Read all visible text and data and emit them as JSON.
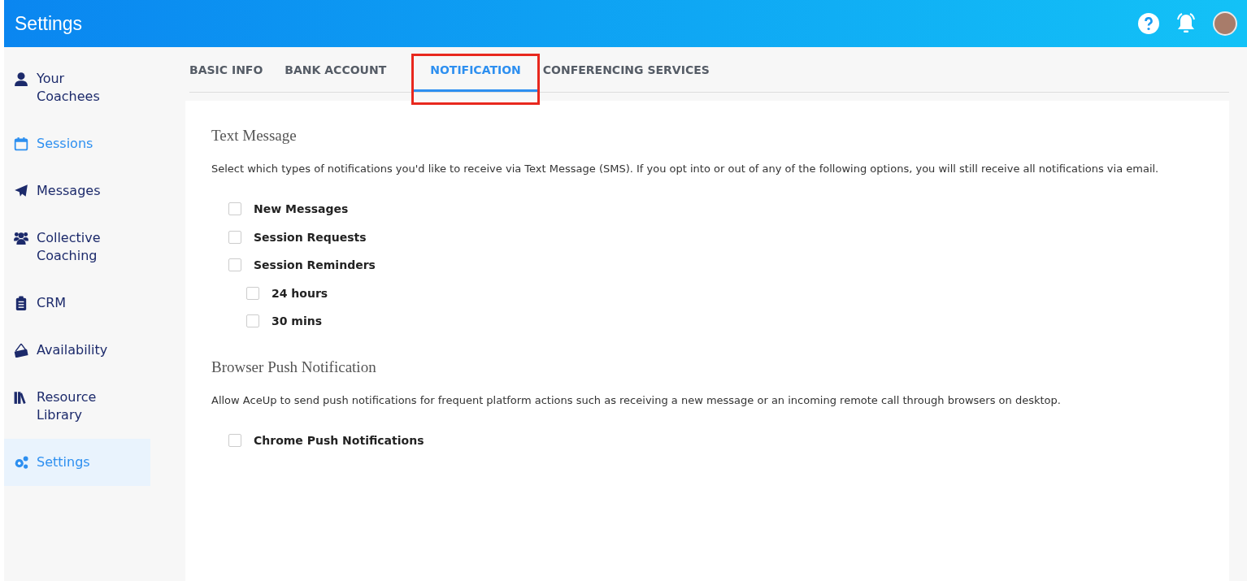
{
  "header": {
    "title": "Settings"
  },
  "sidebar": {
    "items": [
      {
        "label": "Your Coachees",
        "selected": false,
        "highlighted": false
      },
      {
        "label": "Sessions",
        "selected": false,
        "highlighted": true
      },
      {
        "label": "Messages",
        "selected": false,
        "highlighted": false
      },
      {
        "label": "Collective Coaching",
        "selected": false,
        "highlighted": false
      },
      {
        "label": "CRM",
        "selected": false,
        "highlighted": false
      },
      {
        "label": "Availability",
        "selected": false,
        "highlighted": false
      },
      {
        "label": "Resource Library",
        "selected": false,
        "highlighted": false
      },
      {
        "label": "Settings",
        "selected": true,
        "highlighted": false
      }
    ]
  },
  "tabs": [
    {
      "label": "BASIC INFO",
      "selected": false,
      "outlined": false
    },
    {
      "label": "BANK ACCOUNT",
      "selected": false,
      "outlined": false
    },
    {
      "label": "NOTIFICATION",
      "selected": true,
      "outlined": true
    },
    {
      "label": "CONFERENCING SERVICES",
      "selected": false,
      "outlined": false
    }
  ],
  "sections": [
    {
      "title": "Text Message",
      "description": "Select which types of notifications you'd like to receive via Text Message (SMS). If you opt into or out of any of the following options, you will still receive all notifications via email.",
      "options": [
        {
          "label": "New Messages",
          "checked": false
        },
        {
          "label": "Session Requests",
          "checked": false
        },
        {
          "label": "Session Reminders",
          "checked": false,
          "children": [
            {
              "label": "24 hours",
              "checked": false
            },
            {
              "label": "30 mins",
              "checked": false
            }
          ]
        }
      ]
    },
    {
      "title": "Browser Push Notification",
      "description": "Allow AceUp to send push notifications for frequent platform actions such as receiving a new message or an incoming remote call through browsers on desktop.",
      "options": [
        {
          "label": "Chrome Push Notifications",
          "checked": false
        }
      ]
    }
  ]
}
